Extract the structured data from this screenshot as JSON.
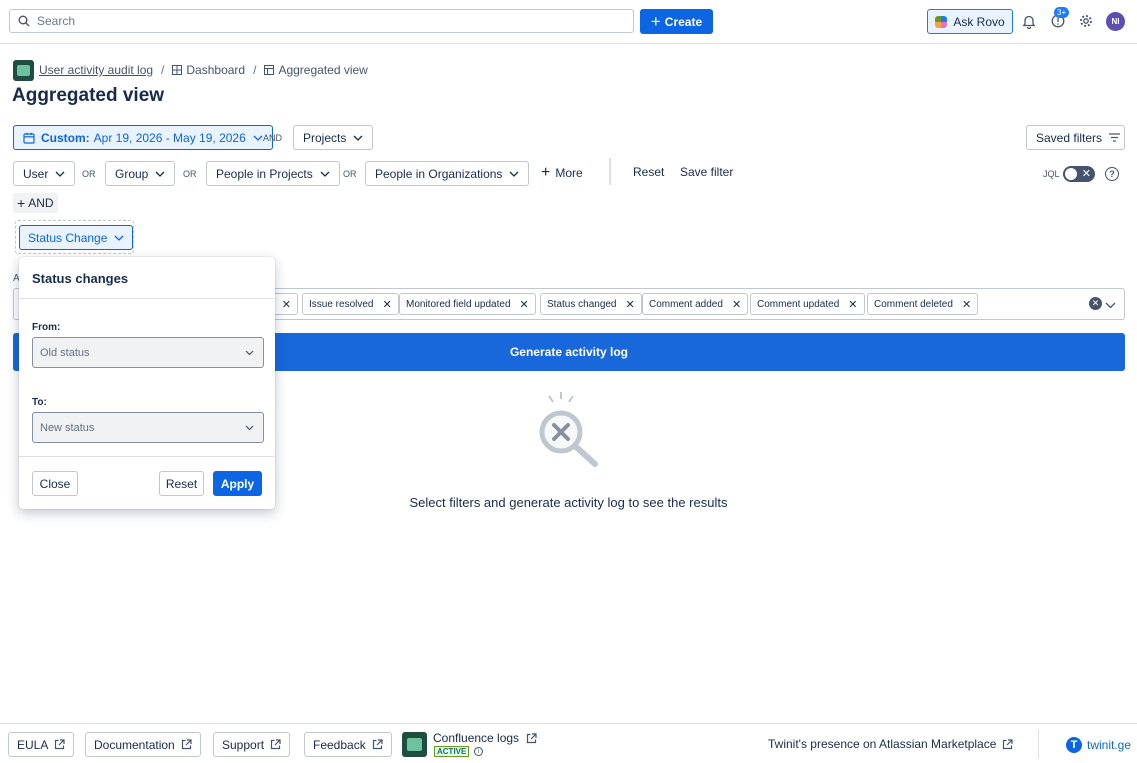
{
  "topbar": {
    "search_placeholder": "Search",
    "create_label": "Create",
    "ask_rovo_label": "Ask Rovo",
    "notification_badge": "3+",
    "avatar_initials": "NI"
  },
  "breadcrumb": {
    "app": "User activity audit log",
    "dashboard": "Dashboard",
    "current": "Aggregated view"
  },
  "page_title": "Aggregated view",
  "filters": {
    "date_range_prefix": "Custom:",
    "date_range": "Apr 19, 2026 - May 19, 2026",
    "and_label": "AND",
    "projects_label": "Projects",
    "saved_filters_label": "Saved filters",
    "user_label": "User",
    "or_label": "OR",
    "group_label": "Group",
    "people_projects_label": "People in Projects",
    "people_orgs_label": "People in Organizations",
    "more_label": "More",
    "reset_label": "Reset",
    "save_filter_label": "Save filter",
    "jql_label": "JQL",
    "add_and_label": "AND",
    "status_change_label": "Status Change"
  },
  "events_label_fragment": "A",
  "event_chips": [
    "Issue resolved",
    "Monitored field updated",
    "Status changed",
    "Comment added",
    "Comment updated",
    "Comment deleted"
  ],
  "generate_label": "Generate activity log",
  "empty_state": "Select filters and generate activity log to see the results",
  "popover": {
    "title": "Status changes",
    "from_label": "From:",
    "from_placeholder": "Old status",
    "to_label": "To:",
    "to_placeholder": "New status",
    "close_label": "Close",
    "reset_label": "Reset",
    "apply_label": "Apply"
  },
  "footer": {
    "eula": "EULA",
    "documentation": "Documentation",
    "support": "Support",
    "feedback": "Feedback",
    "confluence_logs": "Confluence logs",
    "active_badge": "ACTIVE",
    "marketplace": "Twinit's presence on Atlassian Marketplace",
    "brand": "twinit.ge"
  },
  "colors": {
    "primary": "#0c66e4",
    "generate_button": "#1868db",
    "text": "#172b4d",
    "border": "#c1c7d0",
    "avatar": "#5e4db2"
  }
}
